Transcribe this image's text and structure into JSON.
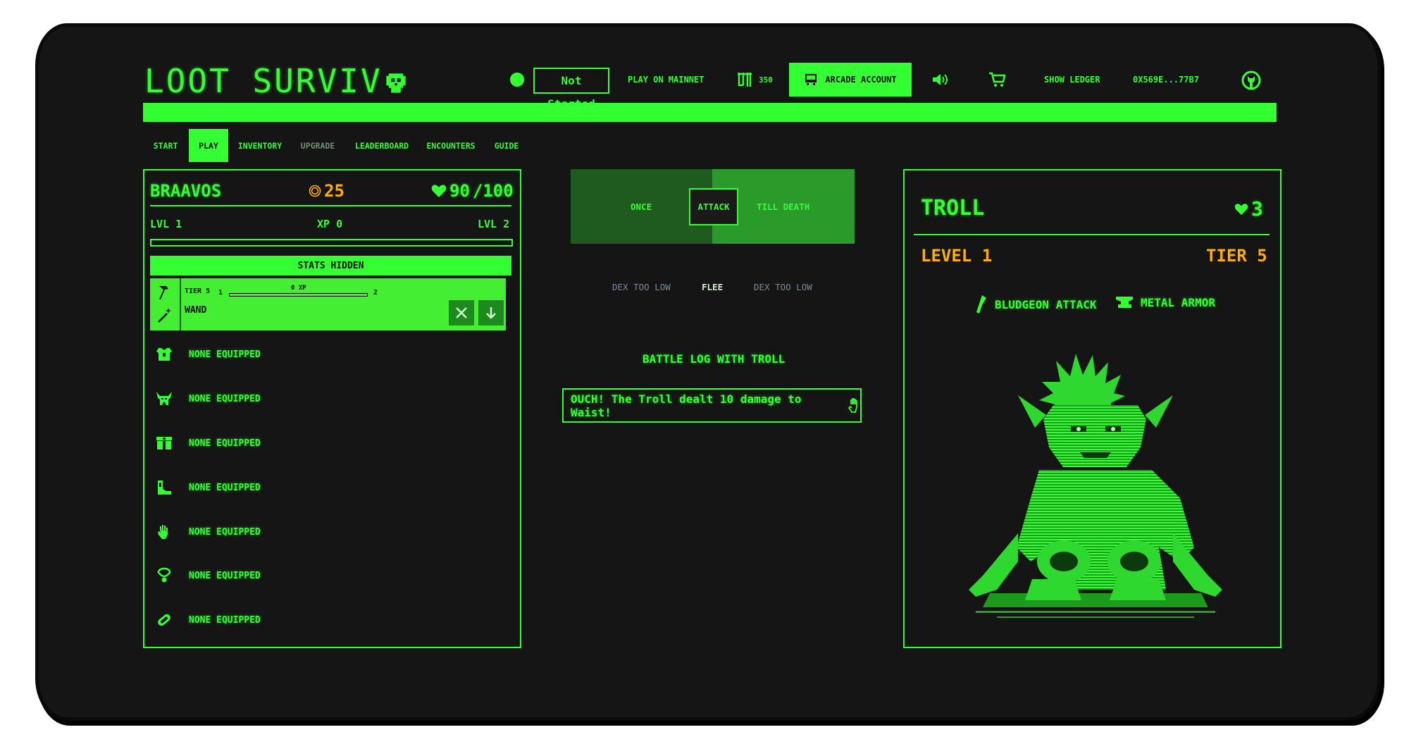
{
  "header": {
    "title": "LOOT SURVIV",
    "status": "Not Started",
    "play_mainnet": "PLAY ON MAINNET",
    "lords_count": "350",
    "arcade_account": "ARCADE ACCOUNT",
    "show_ledger": "SHOW LEDGER",
    "address": "0X569E...77B7"
  },
  "nav": {
    "tabs": [
      {
        "label": "START"
      },
      {
        "label": "PLAY"
      },
      {
        "label": "INVENTORY"
      },
      {
        "label": "UPGRADE"
      },
      {
        "label": "LEADERBOARD"
      },
      {
        "label": "ENCOUNTERS"
      },
      {
        "label": "GUIDE"
      }
    ]
  },
  "adventurer": {
    "name": "BRAAVOS",
    "gold": "25",
    "health": "90",
    "max_health": "/100",
    "level_current": "LVL 1",
    "xp": "XP 0",
    "level_next": "LVL 2",
    "xp_progress": 0,
    "stats_label": "STATS HIDDEN",
    "weapon": {
      "tier": "TIER 5",
      "level_from": "1",
      "xp": "0 XP",
      "level_to": "2",
      "name": "WAND"
    },
    "slots": [
      {
        "icon": "chest-armor-icon",
        "label": "NONE EQUIPPED"
      },
      {
        "icon": "helmet-icon",
        "label": "NONE EQUIPPED"
      },
      {
        "icon": "waist-icon",
        "label": "NONE EQUIPPED"
      },
      {
        "icon": "foot-icon",
        "label": "NONE EQUIPPED"
      },
      {
        "icon": "hand-icon",
        "label": "NONE EQUIPPED"
      },
      {
        "icon": "neck-icon",
        "label": "NONE EQUIPPED"
      },
      {
        "icon": "ring-icon",
        "label": "NONE EQUIPPED"
      }
    ]
  },
  "actions": {
    "once": "ONCE",
    "attack": "ATTACK",
    "till_death": "TILL DEATH",
    "dex_left": "DEX TOO LOW",
    "flee": "FLEE",
    "dex_right": "DEX TOO LOW",
    "battle_log_title": "BATTLE LOG WITH TROLL",
    "battle_log_entry": "OUCH! The Troll dealt 10 damage to Waist!"
  },
  "beast": {
    "name": "TROLL",
    "health": "3",
    "level": "LEVEL 1",
    "tier": "TIER 5",
    "attack": "BLUDGEON ATTACK",
    "armor": "METAL ARMOR"
  },
  "colors": {
    "accent": "#33ff33",
    "background": "#151515",
    "gold": "#ffb000"
  }
}
